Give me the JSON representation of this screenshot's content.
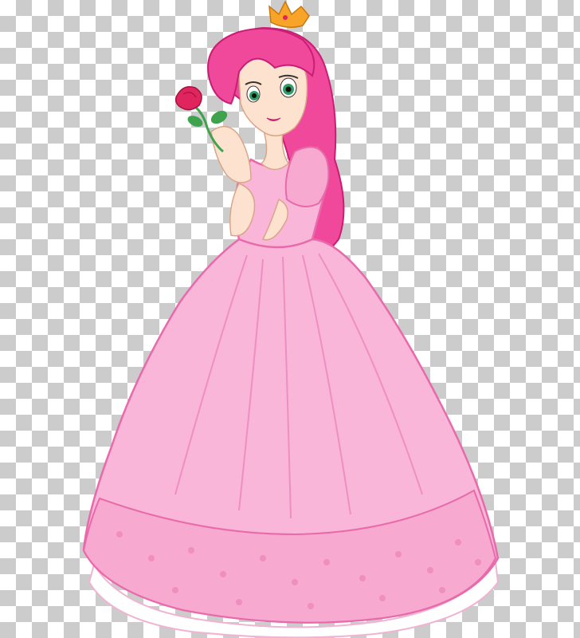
{
  "image": {
    "subject": "princess",
    "background": "transparency-checkerboard",
    "colors": {
      "checker_light": "#ffffff",
      "checker_dark": "#cccccc",
      "dress": "#f9b6d8",
      "dress_shade": "#f08ec2",
      "dress_outline": "#e86aab",
      "hair": "#f0489a",
      "hair_dark": "#c81e74",
      "skin": "#fde3cf",
      "crown": "#f7a428",
      "rose": "#e0245e",
      "leaf": "#3fa34d",
      "eye": "#2f9e63",
      "petticoat": "#ffffff"
    },
    "icons": [
      "crown-icon",
      "rose-icon"
    ]
  }
}
